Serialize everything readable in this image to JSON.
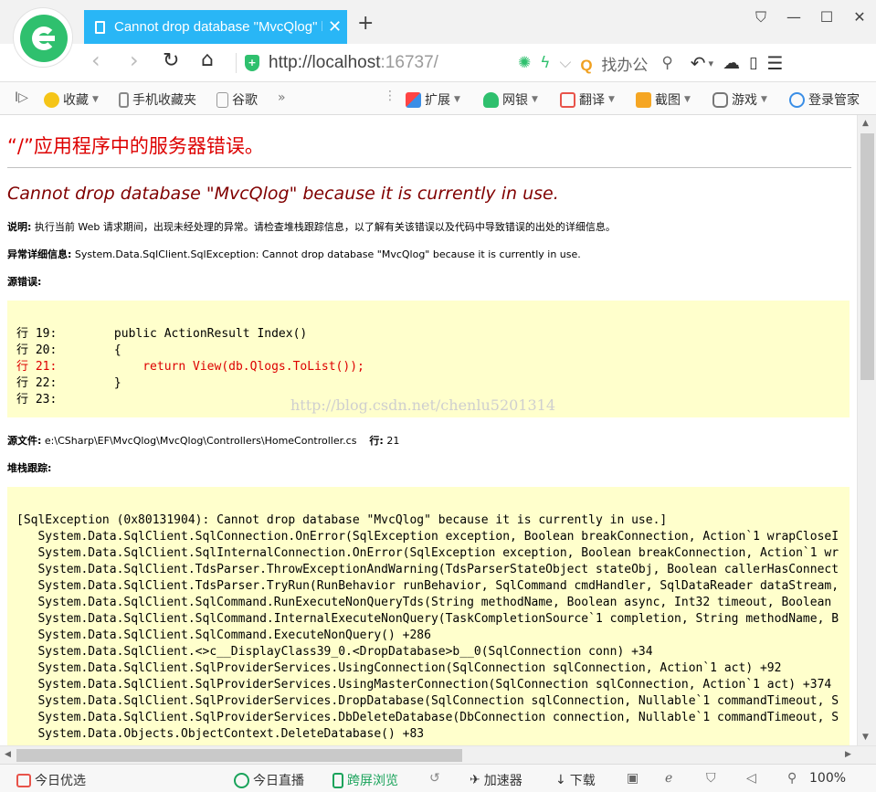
{
  "tab": {
    "title": "Cannot drop database \"MvcQlog\" because it is currently in use.",
    "close": "✕",
    "new_tab": "+"
  },
  "window": {
    "skin": "⛉",
    "minimize": "—",
    "maximize": "☐",
    "close": "✕"
  },
  "address": {
    "back": "‹",
    "forward": "›",
    "reload": "↻",
    "home": "⌂",
    "url_host": "http://localhost",
    "url_rest": ":16737/",
    "search_text": "找办公",
    "search_prefix": "Q",
    "undo": "↶",
    "dropdown": "▾",
    "menu": "☰"
  },
  "favorites": {
    "expand": "I▷",
    "items": [
      {
        "label": "收藏",
        "icon": "star-icon"
      },
      {
        "label": "手机收藏夹",
        "icon": "phone-icon"
      },
      {
        "label": "谷歌",
        "icon": "page-icon"
      }
    ],
    "more": "»",
    "tools": [
      {
        "label": "扩展",
        "icon": "extension-icon"
      },
      {
        "label": "网银",
        "icon": "bank-icon"
      },
      {
        "label": "翻译",
        "icon": "translate-icon"
      },
      {
        "label": "截图",
        "icon": "scissors-icon"
      },
      {
        "label": "游戏",
        "icon": "game-icon"
      },
      {
        "label": "登录管家",
        "icon": "login-icon"
      }
    ]
  },
  "page": {
    "heading": "“/”应用程序中的服务器错误。",
    "error_title": "Cannot drop database \"MvcQlog\" because it is currently in use.",
    "description_label": "说明:",
    "description": "执行当前 Web 请求期间，出现未经处理的异常。请检查堆栈跟踪信息，以了解有关该错误以及代码中导致错误的出处的详细信息。",
    "exception_label": "异常详细信息:",
    "exception": "System.Data.SqlClient.SqlException: Cannot drop database \"MvcQlog\" because it is currently in use.",
    "source_error_label": "源错误:",
    "source_lines": [
      {
        "text": "行 19:        public ActionResult Index()",
        "error": false
      },
      {
        "text": "行 20:        {",
        "error": false
      },
      {
        "text": "行 21:            return View(db.Qlogs.ToList());",
        "error": true
      },
      {
        "text": "行 22:        }",
        "error": false
      },
      {
        "text": "行 23:",
        "error": false
      }
    ],
    "watermark": "http://blog.csdn.net/chenlu5201314",
    "source_file_label": "源文件:",
    "source_file": "e:\\CSharp\\EF\\MvcQlog\\MvcQlog\\Controllers\\HomeController.cs",
    "line_label": "行:",
    "line_value": "21",
    "stack_label": "堆栈跟踪:",
    "stack_lines": [
      "[SqlException (0x80131904): Cannot drop database \"MvcQlog\" because it is currently in use.]",
      "   System.Data.SqlClient.SqlConnection.OnError(SqlException exception, Boolean breakConnection, Action`1 wrapCloseI",
      "   System.Data.SqlClient.SqlInternalConnection.OnError(SqlException exception, Boolean breakConnection, Action`1 wr",
      "   System.Data.SqlClient.TdsParser.ThrowExceptionAndWarning(TdsParserStateObject stateObj, Boolean callerHasConnect",
      "   System.Data.SqlClient.TdsParser.TryRun(RunBehavior runBehavior, SqlCommand cmdHandler, SqlDataReader dataStream,",
      "   System.Data.SqlClient.SqlCommand.RunExecuteNonQueryTds(String methodName, Boolean async, Int32 timeout, Boolean",
      "   System.Data.SqlClient.SqlCommand.InternalExecuteNonQuery(TaskCompletionSource`1 completion, String methodName, B",
      "   System.Data.SqlClient.SqlCommand.ExecuteNonQuery() +286",
      "   System.Data.SqlClient.<>c__DisplayClass39_0.<DropDatabase>b__0(SqlConnection conn) +34",
      "   System.Data.SqlClient.SqlProviderServices.UsingConnection(SqlConnection sqlConnection, Action`1 act) +92",
      "   System.Data.SqlClient.SqlProviderServices.UsingMasterConnection(SqlConnection sqlConnection, Action`1 act) +374",
      "   System.Data.SqlClient.SqlProviderServices.DropDatabase(SqlConnection sqlConnection, Nullable`1 commandTimeout, S",
      "   System.Data.SqlClient.SqlProviderServices.DbDeleteDatabase(DbConnection connection, Nullable`1 commandTimeout, S",
      "   System.Data.Objects.ObjectContext.DeleteDatabase() +83"
    ]
  },
  "scroll": {
    "up": "▲",
    "down": "▼",
    "left": "◀",
    "right": "▶"
  },
  "status": {
    "today": "今日优选",
    "live": "今日直播",
    "split": "跨屏浏览",
    "accelerate": "加速器",
    "download": "下载",
    "zoom": "100%"
  },
  "colors": {
    "tab_active": "#29b6f6",
    "error_heading": "#dd0000",
    "error_title": "#800000",
    "code_bg": "#ffffcc",
    "brand_green": "#2fc06e"
  }
}
